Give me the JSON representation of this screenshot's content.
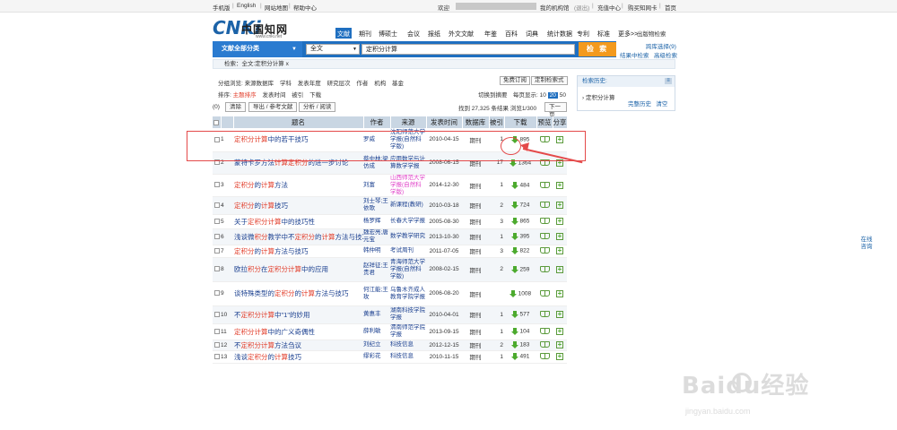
{
  "topbar": {
    "left_links": [
      "手机版",
      "English",
      "网站地图",
      "帮助中心"
    ],
    "welcome": "欢迎",
    "my_org": "我的机构馆",
    "logout": "(退出)",
    "recharge": "充值中心",
    "buy_card": "购买知网卡",
    "home": "首页"
  },
  "logo": {
    "mark": "CNKi",
    "name": "中国知网",
    "url": "www.cnki.net"
  },
  "nav_tabs": [
    "文献",
    "期刊",
    "博硕士",
    "会议",
    "报纸",
    "外文文献",
    "年鉴",
    "百科",
    "词典",
    "统计数据",
    "专利",
    "标准",
    "更多>>"
  ],
  "top_right": {
    "publish": "出版物检索",
    "cross": "跨库选择(9)",
    "in_results": "结果中检索",
    "advanced": "高级检索"
  },
  "search": {
    "scope": "文献全部分类",
    "field": "全文",
    "query": "定积分计算",
    "button": "检 索"
  },
  "breadcrumb": "检索：全文:定积分计算 x",
  "options": {
    "group_label": "分组浏览:",
    "groups": [
      "来源数据库",
      "学科",
      "发表年度",
      "研究层次",
      "作者",
      "机构",
      "基金"
    ],
    "sort_label": "排序:",
    "sorts": [
      "主题排序",
      "发表时间",
      "被引",
      "下载"
    ],
    "free_sub": "免费订阅",
    "custom_sub": "定制检索式",
    "view_switch": "切换到摘要",
    "per_page_label": "每页显示:",
    "per_page_opts": [
      "10",
      "20",
      "50"
    ],
    "per_page_current": "20"
  },
  "actions": {
    "count": "(0)",
    "clear": "清除",
    "export": "导出 / 参考文献",
    "analyze": "分析 / 阅读",
    "found": "找到 27,325 条结果",
    "page": "浏览1/300",
    "next": "下一页"
  },
  "table": {
    "headers": [
      "",
      "题名",
      "作者",
      "来源",
      "发表时间",
      "数据库",
      "被引",
      "下载",
      "预览",
      "分享"
    ],
    "rows": [
      {
        "n": "1",
        "title": [
          [
            "定积分计算",
            1
          ],
          [
            "中的若干技巧",
            0
          ]
        ],
        "author": "罗威",
        "source": "沈阳师范大学学报(自然科学版)",
        "src_pink": false,
        "date": "2010-04-15",
        "db": "期刊",
        "cite": "1",
        "dl": "895"
      },
      {
        "n": "2",
        "title": [
          [
            "蒙特卡罗方法",
            0
          ],
          [
            "计算定积分",
            1
          ],
          [
            "的进一步讨论",
            0
          ]
        ],
        "author": "蔡中林;梁仿成",
        "source": "应用数学与计算数学学报",
        "src_pink": false,
        "date": "2008-06-15",
        "db": "期刊",
        "cite": "17",
        "dl": "1364"
      },
      {
        "n": "3",
        "title": [
          [
            "定积分",
            1
          ],
          [
            "的",
            0
          ],
          [
            "计算",
            1
          ],
          [
            "方法",
            0
          ]
        ],
        "author": "刘富",
        "source": "山西师范大学学报(自然科学版)",
        "src_pink": true,
        "date": "2014-12-30",
        "db": "期刊",
        "cite": "1",
        "dl": "484"
      },
      {
        "n": "4",
        "title": [
          [
            "定积分",
            1
          ],
          [
            "的",
            0
          ],
          [
            "计算",
            1
          ],
          [
            "技巧",
            0
          ]
        ],
        "author": "刘士琴;王依歌",
        "source": "新课程(教研)",
        "src_pink": false,
        "date": "2010-03-18",
        "db": "期刊",
        "cite": "2",
        "dl": "724"
      },
      {
        "n": "5",
        "title": [
          [
            "关于",
            0
          ],
          [
            "定积分计算",
            1
          ],
          [
            "中的技巧性",
            0
          ]
        ],
        "author": "杨罗辉",
        "source": "长春大学学报",
        "src_pink": false,
        "date": "2005-08-30",
        "db": "期刊",
        "cite": "3",
        "dl": "865"
      },
      {
        "n": "6",
        "title": [
          [
            "浅谈微",
            0
          ],
          [
            "积分",
            1
          ],
          [
            "教学中不",
            0
          ],
          [
            "定积分",
            1
          ],
          [
            "的",
            0
          ],
          [
            "计算",
            1
          ],
          [
            "方法与技巧",
            0
          ]
        ],
        "author": "魏宏亮;唐元宝",
        "source": "数学教学研究",
        "src_pink": false,
        "date": "2013-10-30",
        "db": "期刊",
        "cite": "1",
        "dl": "395"
      },
      {
        "n": "7",
        "title": [
          [
            "定积分",
            1
          ],
          [
            "的",
            0
          ],
          [
            "计算",
            1
          ],
          [
            "方法与技巧",
            0
          ]
        ],
        "author": "韩仲明",
        "source": "考试周刊",
        "src_pink": false,
        "date": "2011-07-05",
        "db": "期刊",
        "cite": "3",
        "dl": "822"
      },
      {
        "n": "8",
        "title": [
          [
            "欧拉",
            0
          ],
          [
            "积分",
            1
          ],
          [
            "在",
            0
          ],
          [
            "定积分计算",
            1
          ],
          [
            "中的应用",
            0
          ]
        ],
        "author": "赵祥征;王贵君",
        "source": "青海师范大学学报(自然科学版)",
        "src_pink": false,
        "date": "2008-02-15",
        "db": "期刊",
        "cite": "2",
        "dl": "259"
      },
      {
        "n": "9",
        "title": [
          [
            "谈特殊类型的",
            0
          ],
          [
            "定积分",
            1
          ],
          [
            "的",
            0
          ],
          [
            "计算",
            1
          ],
          [
            "方法与技巧",
            0
          ]
        ],
        "author": "何江能;王玫",
        "source": "乌鲁木齐成人教育学院学报",
        "src_pink": false,
        "date": "2006-08-20",
        "db": "期刊",
        "cite": "",
        "dl": "1008"
      },
      {
        "n": "10",
        "title": [
          [
            "不",
            0
          ],
          [
            "定积分计算",
            1
          ],
          [
            "中\"1\"的妙用",
            0
          ]
        ],
        "author": "黄惠丰",
        "source": "湖南科技学院学报",
        "src_pink": false,
        "date": "2010-04-01",
        "db": "期刊",
        "cite": "1",
        "dl": "577"
      },
      {
        "n": "11",
        "title": [
          [
            "定积分计算",
            1
          ],
          [
            "中的广义奇偶性",
            0
          ]
        ],
        "author": "薛利敏",
        "source": "渭南师范学院学报",
        "src_pink": false,
        "date": "2013-09-15",
        "db": "期刊",
        "cite": "1",
        "dl": "104"
      },
      {
        "n": "12",
        "title": [
          [
            "不",
            0
          ],
          [
            "定积分计算",
            1
          ],
          [
            "方法刍议",
            0
          ]
        ],
        "author": "刘纪立",
        "source": "科技信息",
        "src_pink": false,
        "date": "2012-12-15",
        "db": "期刊",
        "cite": "2",
        "dl": "183"
      },
      {
        "n": "13",
        "title": [
          [
            "浅谈",
            0
          ],
          [
            "定积分",
            1
          ],
          [
            "的",
            0
          ],
          [
            "计算",
            1
          ],
          [
            "技巧",
            0
          ]
        ],
        "author": "缪彩花",
        "source": "科技信息",
        "src_pink": false,
        "date": "2010-11-15",
        "db": "期刊",
        "cite": "1",
        "dl": "491"
      }
    ]
  },
  "history": {
    "title": "检索历史:",
    "item": "定积分计算",
    "full": "完整历史",
    "clear": "清空"
  },
  "side_service": "在线咨询",
  "watermark": {
    "brand": "Baidu经验",
    "url": "jingyan.baidu.com"
  },
  "colors": {
    "accent": "#1f6fc0",
    "keyword": "#e23d2a",
    "search_btn": "#f39a1e",
    "annotation": "#e44a4a",
    "download_icon": "#4caa2e"
  }
}
